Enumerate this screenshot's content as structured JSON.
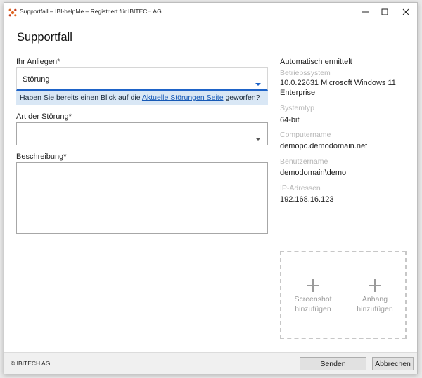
{
  "window": {
    "title": "Supportfall – IBI-helpMe – Registriert für IBITECH AG",
    "icon": "ibi-logo-icon",
    "controls": [
      "minimize-icon",
      "maximize-icon",
      "close-icon"
    ]
  },
  "form": {
    "heading": "Supportfall",
    "anliegen": {
      "label": "Ihr Anliegen*",
      "value": "Störung"
    },
    "info": {
      "prefix": "Haben Sie bereits einen Blick auf die ",
      "link": "Aktuelle Störungen Seite",
      "suffix": " geworfen?"
    },
    "art": {
      "label": "Art der Störung*",
      "value": ""
    },
    "beschreibung": {
      "label": "Beschreibung*",
      "value": ""
    }
  },
  "system": {
    "heading": "Automatisch ermittelt",
    "betriebssystem": {
      "label": "Betriebssystem",
      "value_line1": "10.0.22631 Microsoft Windows 11",
      "value_line2": "Enterprise"
    },
    "systemtyp": {
      "label": "Systemtyp",
      "value": "64-bit"
    },
    "computername": {
      "label": "Computername",
      "value": "demopc.demodomain.net"
    },
    "benutzername": {
      "label": "Benutzername",
      "value": "demodomain\\demo"
    },
    "ip": {
      "label": "IP-Adressen",
      "value": "192.168.16.123"
    }
  },
  "attachments": {
    "screenshot": {
      "line1": "Screenshot",
      "line2": "hinzufügen"
    },
    "anhang": {
      "line1": "Anhang",
      "line2": "hinzufügen"
    }
  },
  "footer": {
    "copyright": "© IBITECH AG",
    "send_label": "Senden",
    "cancel_label": "Abbrechen"
  },
  "colors": {
    "accent": "#1e63c8",
    "info_background": "#d9e7f5",
    "link": "#1659b6",
    "muted_label": "#b6b6b6"
  }
}
